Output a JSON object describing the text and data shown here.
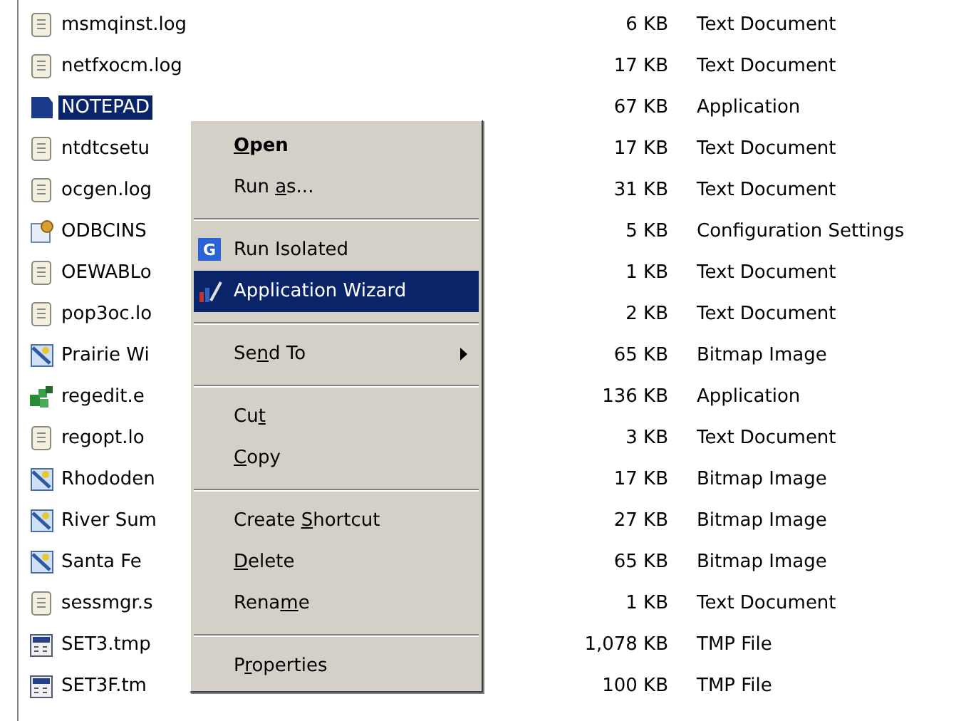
{
  "files": [
    {
      "name": "msmqinst.log",
      "size": "6 KB",
      "type": "Text Document",
      "kind": "text",
      "selected": false
    },
    {
      "name": "netfxocm.log",
      "size": "17 KB",
      "type": "Text Document",
      "kind": "text",
      "selected": false
    },
    {
      "name": "NOTEPAD",
      "size": "67 KB",
      "type": "Application",
      "kind": "app",
      "selected": true
    },
    {
      "name": "ntdtcsetu",
      "size": "17 KB",
      "type": "Text Document",
      "kind": "text",
      "selected": false
    },
    {
      "name": "ocgen.log",
      "size": "31 KB",
      "type": "Text Document",
      "kind": "text",
      "selected": false
    },
    {
      "name": "ODBCINS",
      "size": "5 KB",
      "type": "Configuration Settings",
      "kind": "config",
      "selected": false
    },
    {
      "name": "OEWABLo",
      "size": "1 KB",
      "type": "Text Document",
      "kind": "text",
      "selected": false
    },
    {
      "name": "pop3oc.lo",
      "size": "2 KB",
      "type": "Text Document",
      "kind": "text",
      "selected": false
    },
    {
      "name": "Prairie Wi",
      "size": "65 KB",
      "type": "Bitmap Image",
      "kind": "bitmap",
      "selected": false
    },
    {
      "name": "regedit.e",
      "size": "136 KB",
      "type": "Application",
      "kind": "registry",
      "selected": false
    },
    {
      "name": "regopt.lo",
      "size": "3 KB",
      "type": "Text Document",
      "kind": "text",
      "selected": false
    },
    {
      "name": "Rhododen",
      "size": "17 KB",
      "type": "Bitmap Image",
      "kind": "bitmap",
      "selected": false
    },
    {
      "name": "River Sum",
      "size": "27 KB",
      "type": "Bitmap Image",
      "kind": "bitmap",
      "selected": false
    },
    {
      "name": "Santa Fe",
      "size": "65 KB",
      "type": "Bitmap Image",
      "kind": "bitmap",
      "selected": false
    },
    {
      "name": "sessmgr.s",
      "size": "1 KB",
      "type": "Text Document",
      "kind": "text",
      "selected": false
    },
    {
      "name": "SET3.tmp",
      "size": "1,078 KB",
      "type": "TMP File",
      "kind": "tmp",
      "selected": false
    },
    {
      "name": "SET3F.tm",
      "size": "100 KB",
      "type": "TMP File",
      "kind": "tmp",
      "selected": false
    }
  ],
  "context_menu": [
    {
      "kind": "item",
      "key": "O",
      "suffix": "pen",
      "default": true,
      "selected": false
    },
    {
      "kind": "item",
      "prefix": "Run ",
      "key": "a",
      "suffix": "s...",
      "default": false,
      "selected": false
    },
    {
      "kind": "separator"
    },
    {
      "kind": "isolated",
      "prefix": "Run Isolated",
      "badge": "G",
      "default": false,
      "selected": false
    },
    {
      "kind": "wizard",
      "prefix": "Application Wizard",
      "default": false,
      "selected": true
    },
    {
      "kind": "separator"
    },
    {
      "kind": "submenu",
      "prefix": "Se",
      "key": "n",
      "suffix": "d To",
      "default": false,
      "selected": false
    },
    {
      "kind": "separator"
    },
    {
      "kind": "item",
      "prefix": "Cu",
      "key": "t",
      "default": false,
      "selected": false
    },
    {
      "kind": "item",
      "key": "C",
      "suffix": "opy",
      "default": false,
      "selected": false
    },
    {
      "kind": "separator"
    },
    {
      "kind": "item",
      "prefix": "Create ",
      "key": "S",
      "suffix": "hortcut",
      "default": false,
      "selected": false
    },
    {
      "kind": "item",
      "key": "D",
      "suffix": "elete",
      "default": false,
      "selected": false
    },
    {
      "kind": "item",
      "prefix": "Rena",
      "key": "m",
      "suffix": "e",
      "default": false,
      "selected": false
    },
    {
      "kind": "separator"
    },
    {
      "kind": "item",
      "prefix": "P",
      "key": "r",
      "suffix": "operties",
      "default": false,
      "selected": false
    }
  ]
}
